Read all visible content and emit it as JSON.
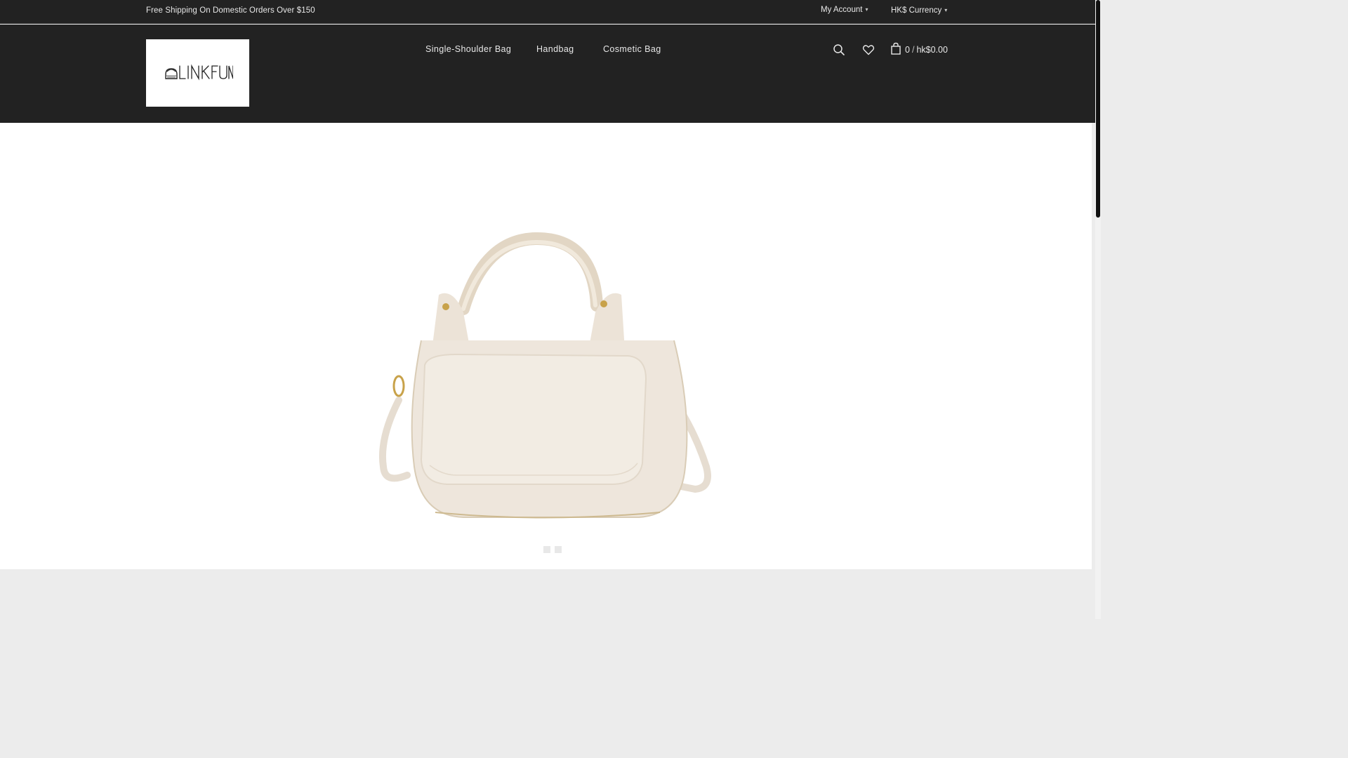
{
  "topbar": {
    "promo": "Free Shipping On Domestic Orders Over $150",
    "account_label": "My Account",
    "currency_label": "HK$ Currency"
  },
  "header": {
    "logo_text": "LINKFUN",
    "nav": [
      {
        "label": "Single-Shoulder Bag"
      },
      {
        "label": "Handbag"
      },
      {
        "label": "Cosmetic Bag"
      }
    ],
    "cart": {
      "count": "0",
      "separator": "/",
      "total": "hk$0.00"
    }
  },
  "hero": {
    "image": "cream-handbag-product",
    "slides": 2,
    "active_slide": 1
  },
  "colors": {
    "header_bg": "#222222",
    "hero_bg": "#ffffff",
    "below_bg": "#ececec",
    "bag_cream": "#eee6dc",
    "handle": "#e2d6c4",
    "hardware_gold": "#c8a24a"
  }
}
